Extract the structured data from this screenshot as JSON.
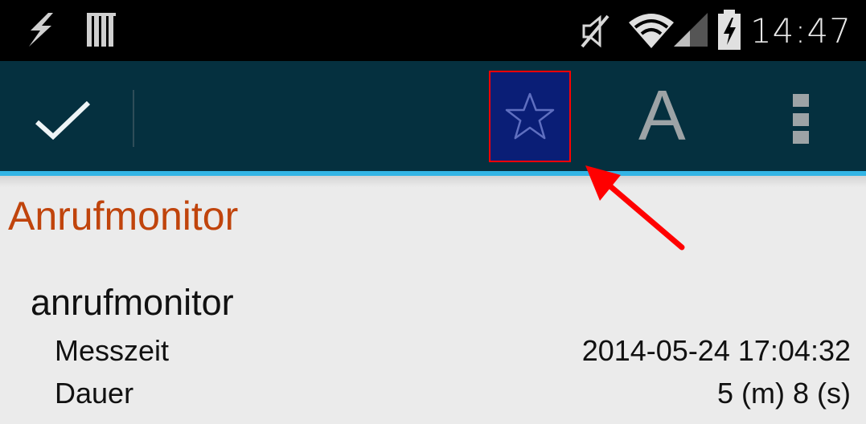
{
  "status_bar": {
    "time": "14:47",
    "icons": [
      "usb-debug-icon",
      "sim-card-icon",
      "muted-icon",
      "wifi-icon",
      "signal-icon",
      "battery-charging-icon"
    ]
  },
  "action_bar": {
    "buttons": [
      "done-check-icon",
      "favorite-star-icon",
      "font-size-icon",
      "overflow-menu-icon"
    ],
    "font_button_label": "A",
    "highlight_color": "#0a1e76",
    "annotation_color": "#ff0000"
  },
  "page": {
    "title": "Anrufmonitor",
    "section": "anrufmonitor",
    "rows": [
      {
        "label": "Messzeit",
        "value": "2014-05-24 17:04:32"
      },
      {
        "label": "Dauer",
        "value": "5 (m) 8 (s)"
      }
    ]
  },
  "colors": {
    "action_bar_bg": "#05303f",
    "accent": "#33b5e5",
    "title": "#c0440c",
    "background": "#ebebeb"
  }
}
